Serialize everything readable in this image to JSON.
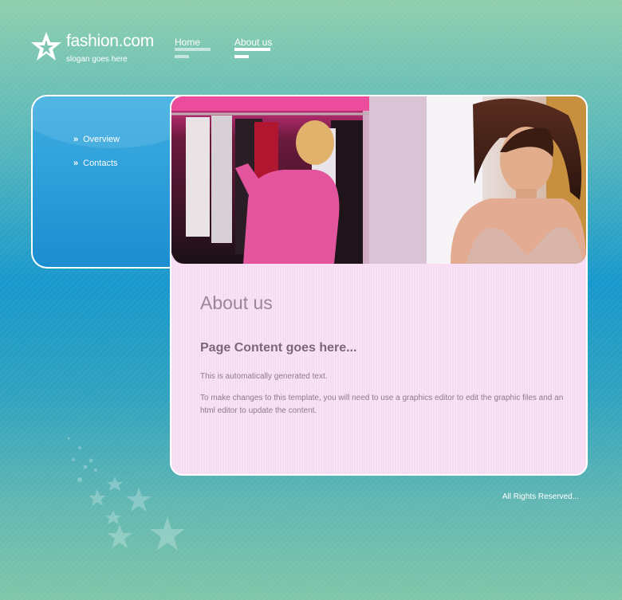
{
  "logo": {
    "name": "fashion.com",
    "slogan": "slogan goes here"
  },
  "nav": [
    {
      "label": "Home",
      "active": false
    },
    {
      "label": "About us",
      "active": true
    }
  ],
  "sidebar": {
    "items": [
      {
        "label": "Overview",
        "icon": "double-chevron-right-icon"
      },
      {
        "label": "Contacts",
        "icon": "double-chevron-right-icon"
      }
    ]
  },
  "main": {
    "title": "About us",
    "heading": "Page Content goes here...",
    "paragraphs": [
      "This is automatically generated text.",
      "To make changes to this template, you will need to use a graphics editor to edit the graphic files and an html editor to update the content."
    ]
  },
  "footer": {
    "text": "All Rights Reserved..."
  },
  "colors": {
    "sidebar_blue": "#1b8ed0",
    "content_pink": "#fbe4f8",
    "title_text": "#9b8698",
    "accent_white": "#ffffff"
  }
}
